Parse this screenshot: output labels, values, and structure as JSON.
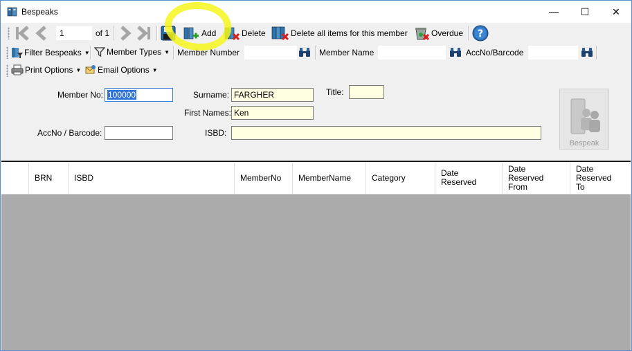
{
  "window": {
    "title": "Bespeaks",
    "minimize_glyph": "—",
    "maximize_glyph": "☐",
    "close_glyph": "✕"
  },
  "navigator": {
    "position": "1",
    "of_label": "of 1",
    "add_label": "Add",
    "delete_label": "Delete",
    "delete_all_label": "Delete all items for this member",
    "overdue_label": "Overdue"
  },
  "filterbar": {
    "filter_bespeaks_label": "Filter Bespeaks",
    "member_types_label": "Member Types",
    "member_number_label": "Member Number",
    "member_number_value": "",
    "member_name_label": "Member Name",
    "member_name_value": "",
    "accno_label": "AccNo/Barcode",
    "accno_value": ""
  },
  "optionsbar": {
    "print_options_label": "Print Options",
    "email_options_label": "Email Options"
  },
  "form": {
    "member_no_label": "Member No:",
    "member_no_value": "100000",
    "surname_label": "Surname:",
    "surname_value": "FARGHER",
    "title_label": "Title:",
    "title_value": "",
    "first_names_label": "First Names:",
    "first_names_value": "Ken",
    "accno_label": "AccNo / Barcode:",
    "accno_value": "",
    "isbd_label": "ISBD:",
    "isbd_value": "",
    "bespeak_button_label": "Bespeak"
  },
  "grid": {
    "columns": [
      "",
      "BRN",
      "ISBD",
      "MemberNo",
      "MemberName",
      "Category",
      "Date\nReserved",
      "Date\nReserved\nFrom",
      "Date\nReserved\nTo"
    ],
    "rows": []
  },
  "colors": {
    "highlight": "#f6f61e",
    "selection": "#3375d6",
    "required_field": "#ffffe1",
    "grid_background": "#ababab"
  },
  "icons": [
    "book-icon",
    "first-record-icon",
    "previous-record-icon",
    "next-record-icon",
    "last-record-icon",
    "save-icon",
    "add-book-icon",
    "delete-book-icon",
    "delete-all-icon",
    "overdue-bin-icon",
    "help-icon",
    "filter-icon",
    "funnel-icon",
    "binoculars-icon",
    "printer-icon",
    "email-icon",
    "bespeak-members-icon"
  ]
}
